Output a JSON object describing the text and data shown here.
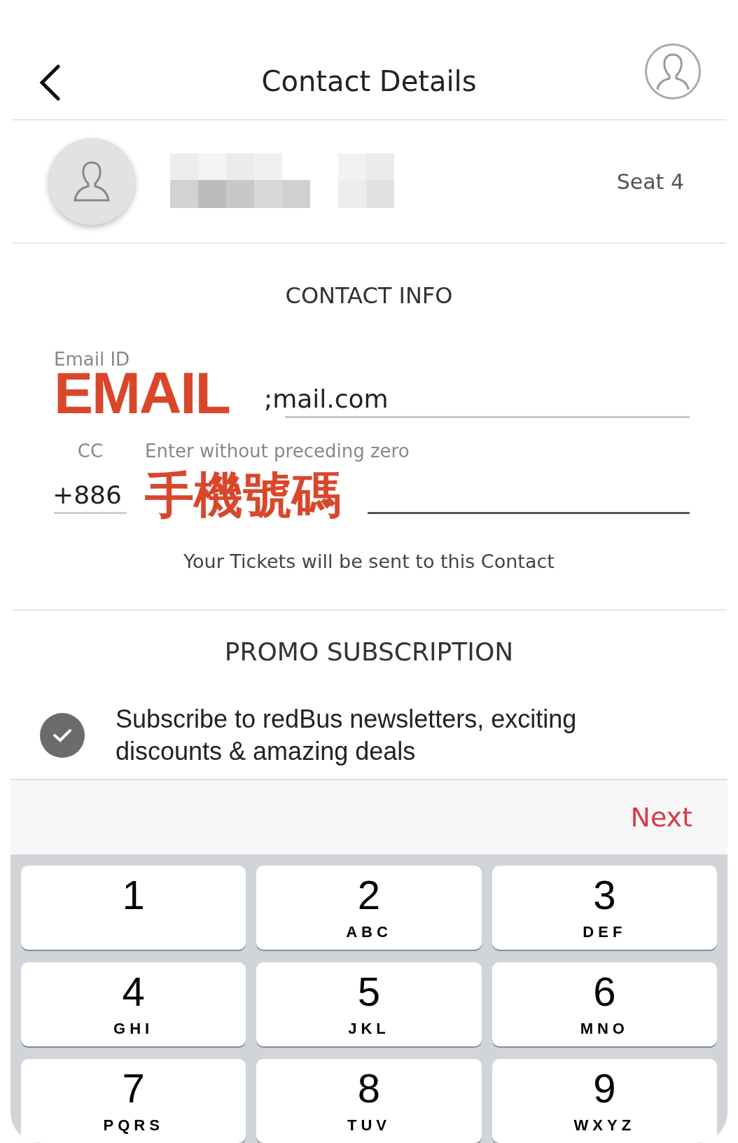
{
  "header": {
    "title": "Contact Details"
  },
  "passenger": {
    "seat": "Seat 4"
  },
  "contact_info": {
    "heading": "CONTACT INFO",
    "email_label": "Email ID",
    "email_value": ";mail.com",
    "email_overlay": "EMAIL",
    "cc_label": "CC",
    "cc_value": "+886",
    "phone_placeholder": "Enter without preceding zero",
    "phone_overlay": "手機號碼",
    "note": "Your Tickets will be sent to this Contact"
  },
  "promo": {
    "heading": "PROMO SUBSCRIPTION",
    "checked": true,
    "label": "Subscribe to redBus newsletters, exciting discounts & amazing deals"
  },
  "keyboard_toolbar": {
    "next": "Next"
  },
  "keys": [
    {
      "digit": "1"
    },
    {
      "digit": "2",
      "letters": "ABC"
    },
    {
      "digit": "3",
      "letters": "DEF"
    },
    {
      "digit": "4",
      "letters": "GHI"
    },
    {
      "digit": "5",
      "letters": "JKL"
    },
    {
      "digit": "6",
      "letters": "MNO"
    },
    {
      "digit": "7",
      "letters": "PQRS"
    },
    {
      "digit": "8",
      "letters": "TUV"
    },
    {
      "digit": "9",
      "letters": "WXYZ"
    }
  ]
}
